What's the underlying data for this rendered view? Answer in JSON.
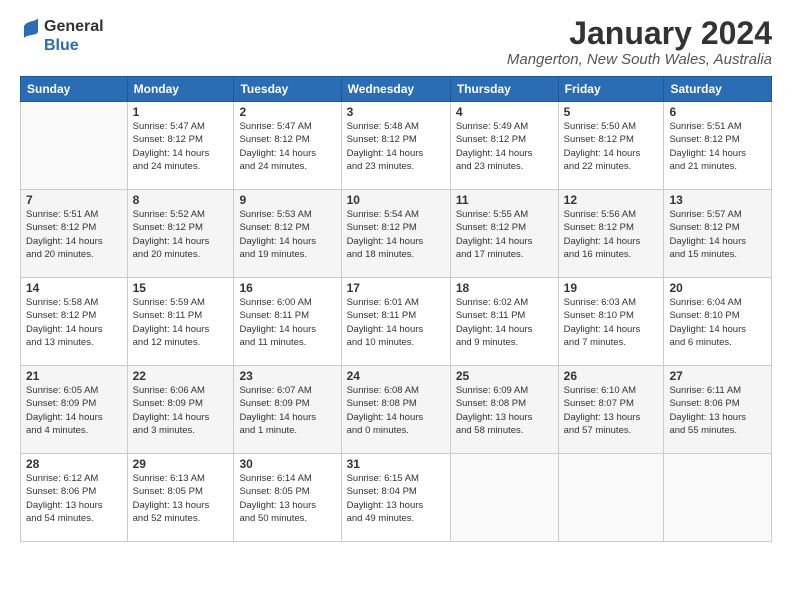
{
  "logo": {
    "line1": "General",
    "line2": "Blue"
  },
  "title": "January 2024",
  "location": "Mangerton, New South Wales, Australia",
  "days_header": [
    "Sunday",
    "Monday",
    "Tuesday",
    "Wednesday",
    "Thursday",
    "Friday",
    "Saturday"
  ],
  "weeks": [
    [
      {
        "day": "",
        "info": ""
      },
      {
        "day": "1",
        "info": "Sunrise: 5:47 AM\nSunset: 8:12 PM\nDaylight: 14 hours\nand 24 minutes."
      },
      {
        "day": "2",
        "info": "Sunrise: 5:47 AM\nSunset: 8:12 PM\nDaylight: 14 hours\nand 24 minutes."
      },
      {
        "day": "3",
        "info": "Sunrise: 5:48 AM\nSunset: 8:12 PM\nDaylight: 14 hours\nand 23 minutes."
      },
      {
        "day": "4",
        "info": "Sunrise: 5:49 AM\nSunset: 8:12 PM\nDaylight: 14 hours\nand 23 minutes."
      },
      {
        "day": "5",
        "info": "Sunrise: 5:50 AM\nSunset: 8:12 PM\nDaylight: 14 hours\nand 22 minutes."
      },
      {
        "day": "6",
        "info": "Sunrise: 5:51 AM\nSunset: 8:12 PM\nDaylight: 14 hours\nand 21 minutes."
      }
    ],
    [
      {
        "day": "7",
        "info": "Sunrise: 5:51 AM\nSunset: 8:12 PM\nDaylight: 14 hours\nand 20 minutes."
      },
      {
        "day": "8",
        "info": "Sunrise: 5:52 AM\nSunset: 8:12 PM\nDaylight: 14 hours\nand 20 minutes."
      },
      {
        "day": "9",
        "info": "Sunrise: 5:53 AM\nSunset: 8:12 PM\nDaylight: 14 hours\nand 19 minutes."
      },
      {
        "day": "10",
        "info": "Sunrise: 5:54 AM\nSunset: 8:12 PM\nDaylight: 14 hours\nand 18 minutes."
      },
      {
        "day": "11",
        "info": "Sunrise: 5:55 AM\nSunset: 8:12 PM\nDaylight: 14 hours\nand 17 minutes."
      },
      {
        "day": "12",
        "info": "Sunrise: 5:56 AM\nSunset: 8:12 PM\nDaylight: 14 hours\nand 16 minutes."
      },
      {
        "day": "13",
        "info": "Sunrise: 5:57 AM\nSunset: 8:12 PM\nDaylight: 14 hours\nand 15 minutes."
      }
    ],
    [
      {
        "day": "14",
        "info": "Sunrise: 5:58 AM\nSunset: 8:12 PM\nDaylight: 14 hours\nand 13 minutes."
      },
      {
        "day": "15",
        "info": "Sunrise: 5:59 AM\nSunset: 8:11 PM\nDaylight: 14 hours\nand 12 minutes."
      },
      {
        "day": "16",
        "info": "Sunrise: 6:00 AM\nSunset: 8:11 PM\nDaylight: 14 hours\nand 11 minutes."
      },
      {
        "day": "17",
        "info": "Sunrise: 6:01 AM\nSunset: 8:11 PM\nDaylight: 14 hours\nand 10 minutes."
      },
      {
        "day": "18",
        "info": "Sunrise: 6:02 AM\nSunset: 8:11 PM\nDaylight: 14 hours\nand 9 minutes."
      },
      {
        "day": "19",
        "info": "Sunrise: 6:03 AM\nSunset: 8:10 PM\nDaylight: 14 hours\nand 7 minutes."
      },
      {
        "day": "20",
        "info": "Sunrise: 6:04 AM\nSunset: 8:10 PM\nDaylight: 14 hours\nand 6 minutes."
      }
    ],
    [
      {
        "day": "21",
        "info": "Sunrise: 6:05 AM\nSunset: 8:09 PM\nDaylight: 14 hours\nand 4 minutes."
      },
      {
        "day": "22",
        "info": "Sunrise: 6:06 AM\nSunset: 8:09 PM\nDaylight: 14 hours\nand 3 minutes."
      },
      {
        "day": "23",
        "info": "Sunrise: 6:07 AM\nSunset: 8:09 PM\nDaylight: 14 hours\nand 1 minute."
      },
      {
        "day": "24",
        "info": "Sunrise: 6:08 AM\nSunset: 8:08 PM\nDaylight: 14 hours\nand 0 minutes."
      },
      {
        "day": "25",
        "info": "Sunrise: 6:09 AM\nSunset: 8:08 PM\nDaylight: 13 hours\nand 58 minutes."
      },
      {
        "day": "26",
        "info": "Sunrise: 6:10 AM\nSunset: 8:07 PM\nDaylight: 13 hours\nand 57 minutes."
      },
      {
        "day": "27",
        "info": "Sunrise: 6:11 AM\nSunset: 8:06 PM\nDaylight: 13 hours\nand 55 minutes."
      }
    ],
    [
      {
        "day": "28",
        "info": "Sunrise: 6:12 AM\nSunset: 8:06 PM\nDaylight: 13 hours\nand 54 minutes."
      },
      {
        "day": "29",
        "info": "Sunrise: 6:13 AM\nSunset: 8:05 PM\nDaylight: 13 hours\nand 52 minutes."
      },
      {
        "day": "30",
        "info": "Sunrise: 6:14 AM\nSunset: 8:05 PM\nDaylight: 13 hours\nand 50 minutes."
      },
      {
        "day": "31",
        "info": "Sunrise: 6:15 AM\nSunset: 8:04 PM\nDaylight: 13 hours\nand 49 minutes."
      },
      {
        "day": "",
        "info": ""
      },
      {
        "day": "",
        "info": ""
      },
      {
        "day": "",
        "info": ""
      }
    ]
  ]
}
